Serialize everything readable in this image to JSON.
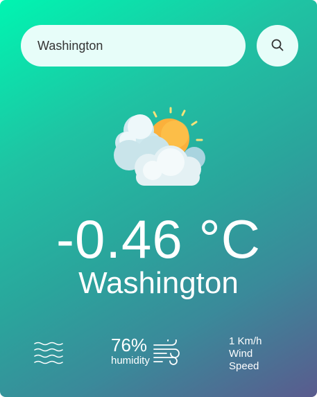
{
  "search": {
    "value": "Washington",
    "placeholder": ""
  },
  "icons": {
    "search": "search-icon",
    "weather": "partly-cloudy-icon",
    "humidity": "water-waves-icon",
    "wind": "wind-icon"
  },
  "weather": {
    "temperature": "-0.46 °C",
    "city": "Washington"
  },
  "details": {
    "humidity_value": "76%",
    "humidity_label": "humidity",
    "wind_value": "1 Km/h",
    "wind_label": "Wind Speed"
  },
  "colors": {
    "gradient_start": "#00f5b1",
    "gradient_end": "#5a5b8e",
    "input_background": "#e7fdf9",
    "text": "#ffffff"
  }
}
